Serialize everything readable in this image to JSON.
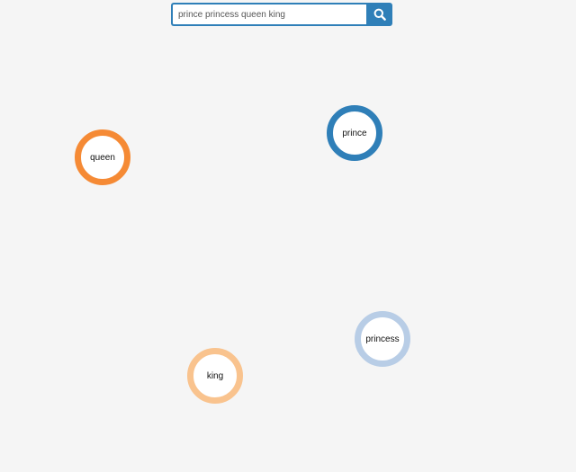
{
  "search": {
    "value": "prince princess queen king",
    "button_icon": "search-icon"
  },
  "nodes": [
    {
      "id": "prince",
      "label": "prince",
      "color": "#2f7fb8"
    },
    {
      "id": "queen",
      "label": "queen",
      "color": "#f58a35"
    },
    {
      "id": "princess",
      "label": "princess",
      "color": "#b8cde6"
    },
    {
      "id": "king",
      "label": "king",
      "color": "#f9c38e"
    }
  ]
}
